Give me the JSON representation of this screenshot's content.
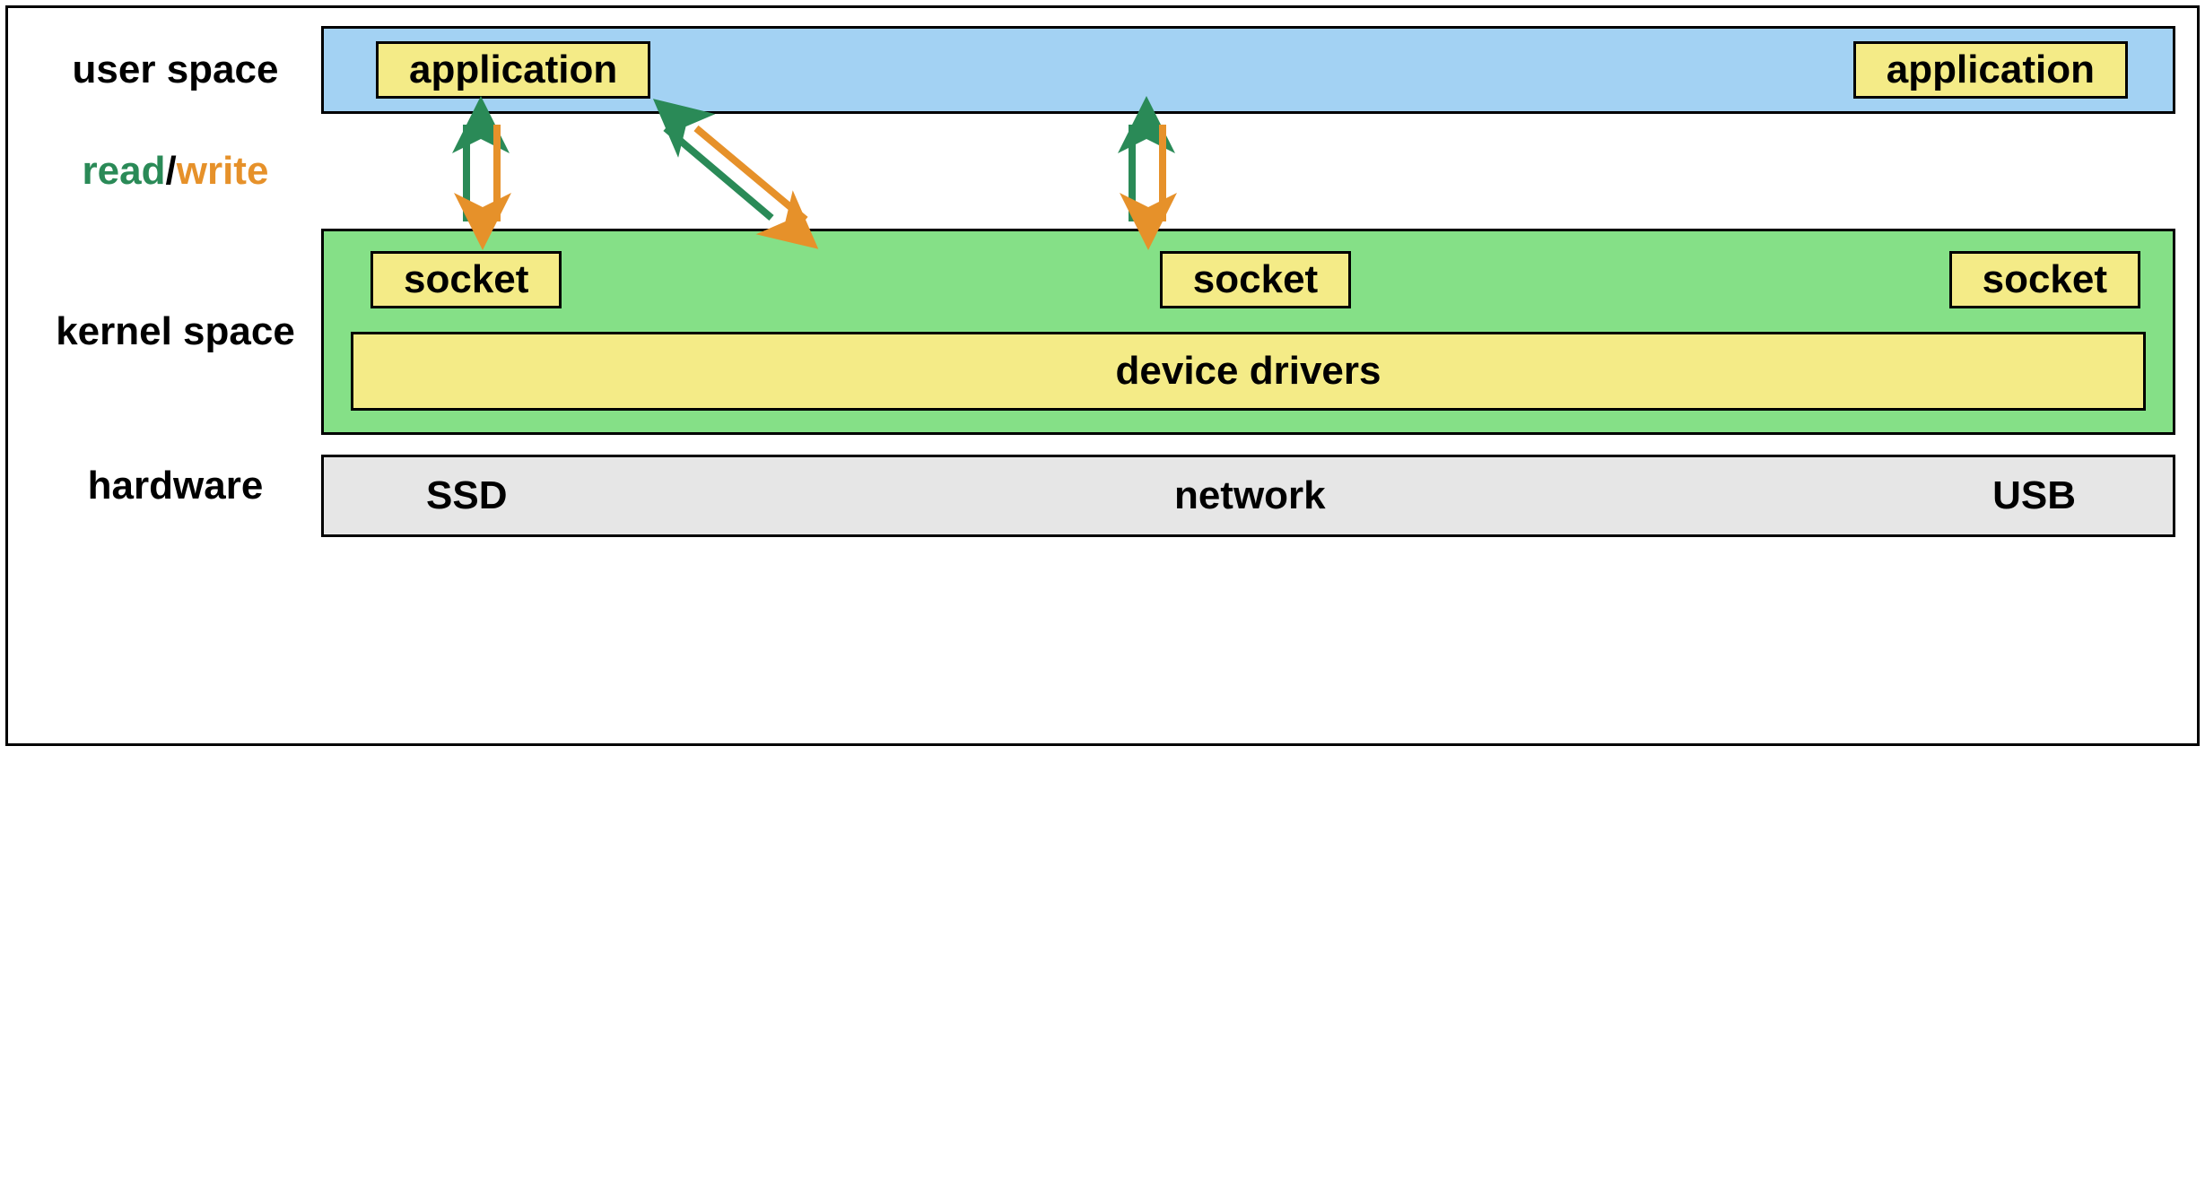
{
  "labels": {
    "user_space": "user space",
    "read": "read",
    "slash": "/",
    "write": "write",
    "kernel_space": "kernel space",
    "hardware": "hardware"
  },
  "user": {
    "app1": "application",
    "app2": "application"
  },
  "kernel": {
    "sockets": [
      "socket",
      "socket",
      "socket"
    ],
    "device_drivers": "device drivers"
  },
  "hardware": {
    "items": [
      "SSD",
      "network",
      "USB"
    ]
  },
  "colors": {
    "read_arrow": "#2a8a57",
    "write_arrow": "#e6912a",
    "user_band": "#a3d2f3",
    "kernel_band": "#85e087",
    "hw_band": "#e6e6e6",
    "yellow": "#f4eb87"
  }
}
